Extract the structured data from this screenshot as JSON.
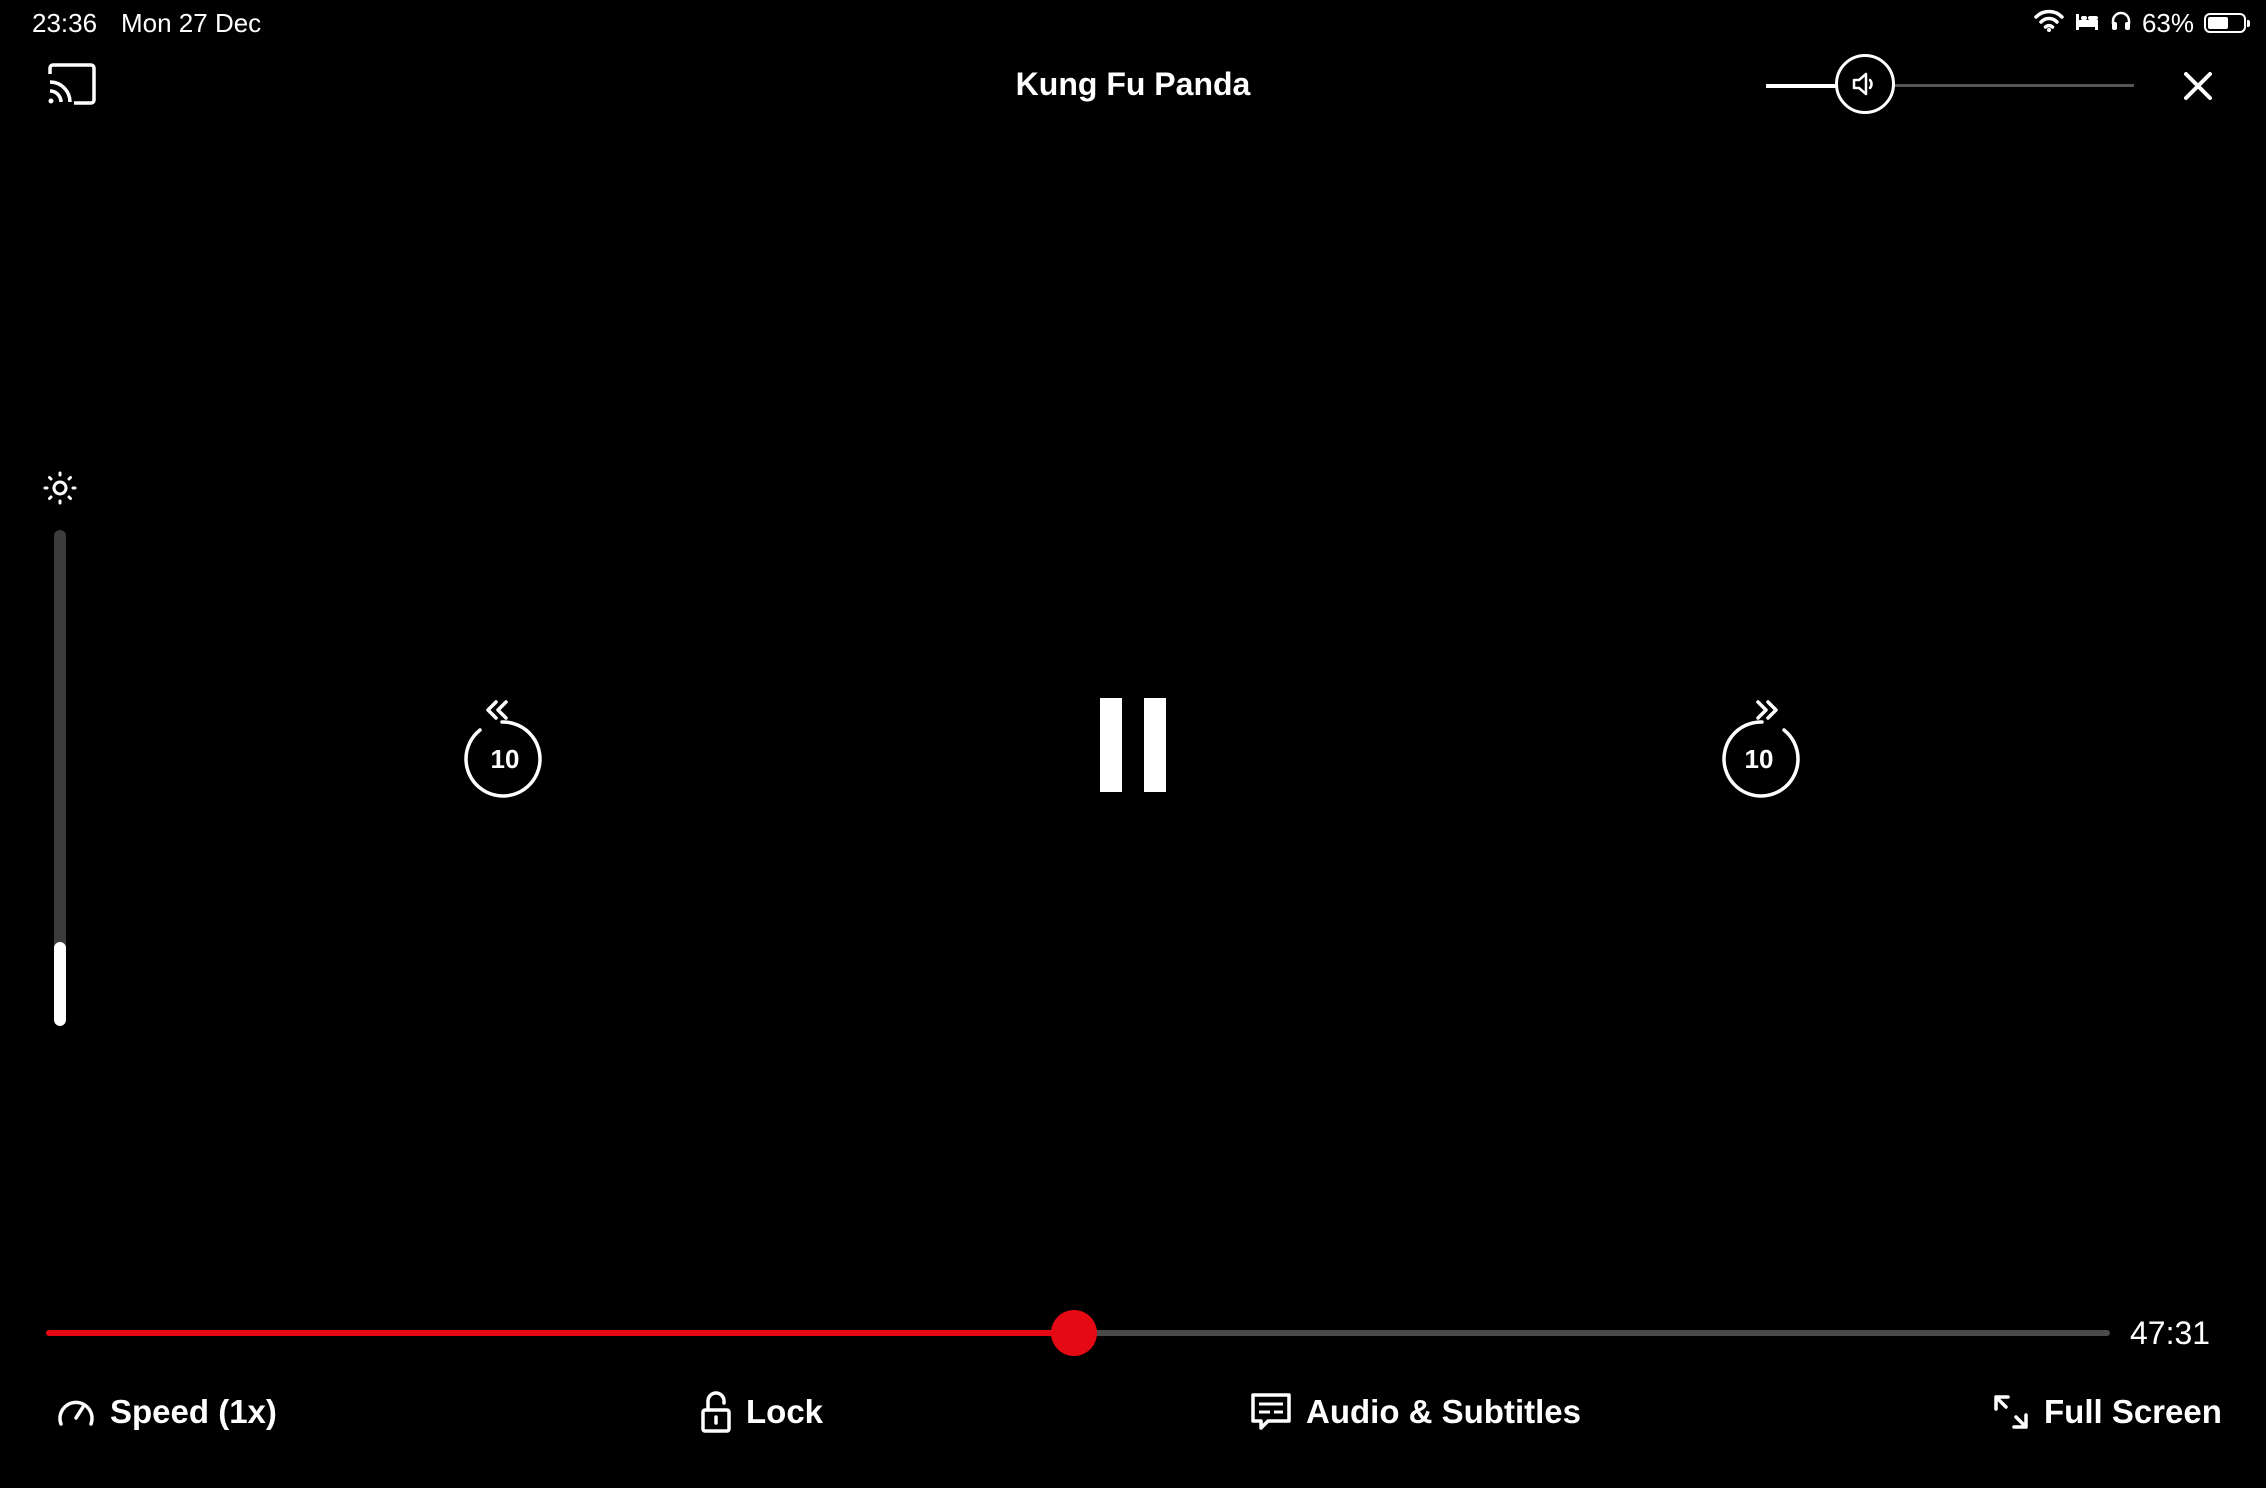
{
  "status_bar": {
    "time": "23:36",
    "date": "Mon 27 Dec",
    "battery_percent": "63%",
    "battery_level": 0.63,
    "icons": [
      "wifi-icon",
      "sleep-icon",
      "headphones-icon",
      "battery-icon"
    ]
  },
  "player": {
    "title": "Kung Fu Panda",
    "volume_level": 0.27,
    "brightness_level": 0.17,
    "skip_back_label": "10",
    "skip_forward_label": "10",
    "progress_fraction": 0.498,
    "time_remaining": "47:31"
  },
  "controls": {
    "speed_label": "Speed (1x)",
    "lock_label": "Lock",
    "audio_subtitles_label": "Audio & Subtitles",
    "full_screen_label": "Full Screen"
  },
  "colors": {
    "accent": "#e50914",
    "background": "#000000",
    "text": "#ffffff"
  }
}
